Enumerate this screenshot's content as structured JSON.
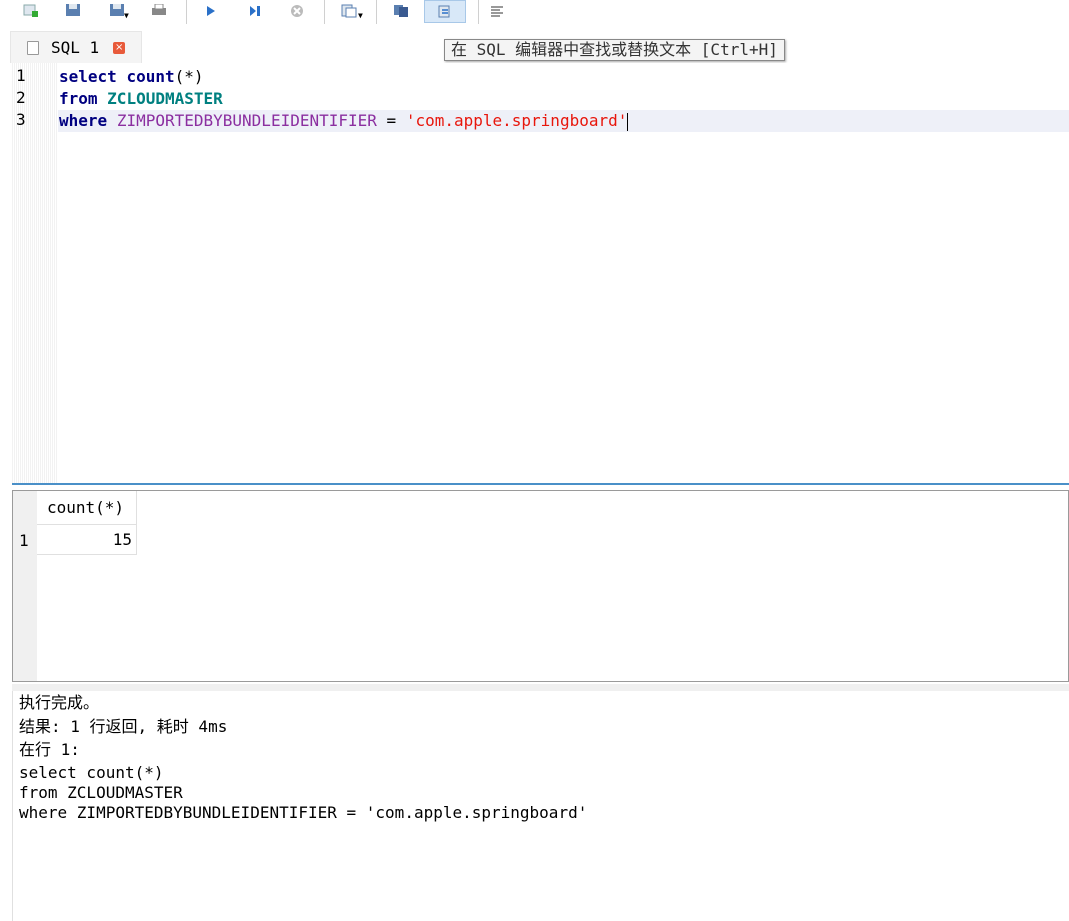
{
  "toolbar": {
    "buttons": [
      {
        "name": "new-query-icon"
      },
      {
        "name": "save-icon"
      },
      {
        "name": "save-as-icon"
      },
      {
        "name": "print-icon"
      },
      {
        "name": "run-icon"
      },
      {
        "name": "run-step-icon"
      },
      {
        "name": "stop-icon"
      },
      {
        "name": "format-icon"
      },
      {
        "name": "copy-icon"
      },
      {
        "name": "find-replace-icon"
      },
      {
        "name": "text-align-icon"
      }
    ]
  },
  "tab": {
    "label": "SQL 1",
    "close_glyph": "×"
  },
  "tooltip": "在 SQL 编辑器中查找或替换文本 [Ctrl+H]",
  "editor": {
    "line_numbers": [
      "1",
      "2",
      "3"
    ],
    "lines": [
      {
        "kw": "select",
        "rest1": " ",
        "fn": "count",
        "rest2": "(*)"
      },
      {
        "kw": "from",
        "rest1": " ",
        "tbl": "ZCLOUDMASTER"
      },
      {
        "kw": "where",
        "rest1": " ",
        "col": "ZIMPORTEDBYBUNDLEIDENTIFIER",
        "op": " = ",
        "str": "'com.apple.springboard'"
      }
    ]
  },
  "results": {
    "columns": [
      "count(*)"
    ],
    "rows": [
      {
        "num": "1",
        "values": [
          "15"
        ]
      }
    ]
  },
  "output": {
    "lines": [
      "执行完成。",
      "结果: 1 行返回, 耗时 4ms",
      "在行 1:",
      "select count(*)",
      "from ZCLOUDMASTER",
      "where ZIMPORTEDBYBUNDLEIDENTIFIER = 'com.apple.springboard'"
    ]
  }
}
